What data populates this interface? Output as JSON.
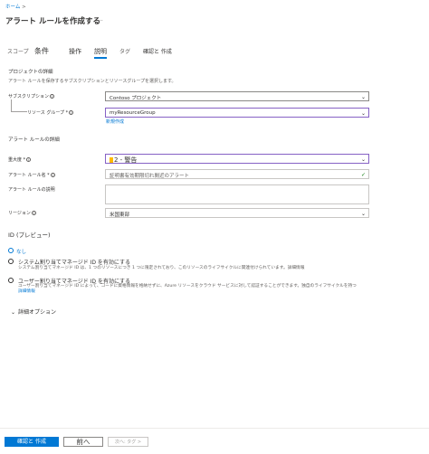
{
  "breadcrumb": {
    "home": "ホーム",
    "sep": ">"
  },
  "header": {
    "title": "アラート ルールを作成する",
    "more": "..."
  },
  "tabs": [
    {
      "label": "スコープ"
    },
    {
      "label": "条件"
    },
    {
      "label": "操作"
    },
    {
      "label": "説明"
    },
    {
      "label": "タグ"
    },
    {
      "label": "確認と 作成"
    }
  ],
  "project": {
    "section": "プロジェクトの詳細",
    "desc": "アラート ルールを保存するサブスクリプションとリソースグループを選択します。",
    "subscription_label": "サブスクリプション",
    "subscription_value": "Contoso プロジェクト",
    "rg_label": "リソース グループ *",
    "rg_value": "myResourceGroup",
    "create_new": "新規作成"
  },
  "details": {
    "section": "アラート ルールの詳細",
    "severity_label": "重大度 *",
    "severity_value": "2 - 警告",
    "name_label": "アラート ルール名 *",
    "name_value": "証明書有効期限切れ間近のアラート",
    "desc_label": "アラート ルールの説明",
    "region_label": "リージョン",
    "region_value": "米国東部"
  },
  "identity": {
    "title": "ID (プレビュー)",
    "none": "なし",
    "system_title": "システム割り当てマネージド ID を有効にする",
    "system_desc": "システム割り当てマネージド ID は、1 つのリソースにつき 1 つに限定されており、このリソースのライフサイクルに関連付けられています。詳細情報",
    "user_title": "ユーザー割り当てマネージド ID を有効にする",
    "user_desc": "ユーザー割り当てマネージド ID によって、コードに資格情報を格納せずに、Azure リソースをクラウド サービスに対して認証することができます。独自のライフサイクルを持つ",
    "user_link": "詳細情報"
  },
  "advanced": {
    "label": "詳細オプション"
  },
  "footer": {
    "review": "確認と 作成",
    "prev": "前へ",
    "next": "次へ: タグ >"
  },
  "colors": {
    "accent": "#0078d4",
    "warning": "#ffb900",
    "valid": "#8661c5"
  }
}
